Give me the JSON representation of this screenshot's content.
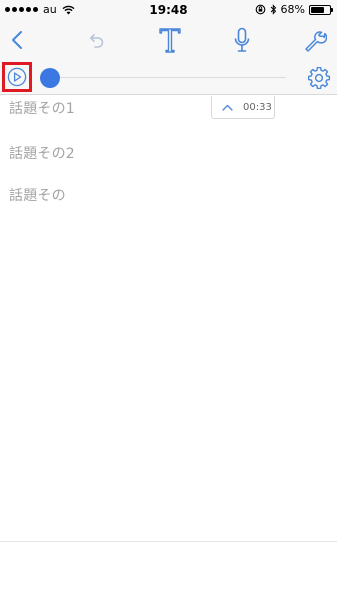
{
  "status_bar": {
    "carrier": "au",
    "time": "19:48",
    "battery_percent": "68%",
    "battery_level": 0.68
  },
  "toolbar": {
    "icons": [
      "back-icon",
      "undo-icon",
      "text-icon",
      "microphone-icon",
      "wrench-icon"
    ]
  },
  "player": {
    "time": "00:33",
    "progress": 0.0
  },
  "notes": [
    "話題その1",
    "話題その2",
    "話題その"
  ],
  "colors": {
    "accent": "#3c78e2",
    "icon_blue": "#4a86d9",
    "disabled_gray": "#b8c4d6",
    "highlight_red": "#e01a22",
    "note_text": "#a3a3a3"
  }
}
